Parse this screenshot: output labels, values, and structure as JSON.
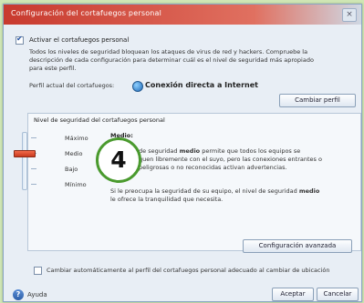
{
  "window": {
    "title": "Configuración del cortafuegos personal",
    "close_glyph": "×"
  },
  "main": {
    "enable_checkbox_label": "Activar el cortafuegos personal",
    "enable_checked": true,
    "description_line1": "Todos los niveles de seguridad bloquean los ataques de virus de red y hackers. Compruebe la",
    "description_line2": "descripción de cada configuración para determinar cuál es el nivel de seguridad más apropiado",
    "description_line3": "para este perfil.",
    "profile_label": "Perfil actual del cortafuegos:",
    "profile_value": "Conexión directa a Internet",
    "change_profile_button": "Cambiar perfil"
  },
  "security_group": {
    "title": "Nivel de seguridad del cortafuegos personal",
    "levels": [
      "Máximo",
      "Medio",
      "Bajo",
      "Mínimo"
    ],
    "selected_level": "Medio",
    "heading": "Medio:",
    "desc_line1_a": "de seguridad ",
    "desc_line1_bold": "medio",
    "desc_line1_b": " permite que todos los equipos se",
    "desc_line2": "quen libremente con el suyo, pero las conexiones entrantes o",
    "desc_line3": "peligrosas o no reconocidas activan advertencias.",
    "desc_line4_a": "Si le preocupa la seguridad de su equipo, el nivel de seguridad ",
    "desc_line4_bold": "medio",
    "desc_line5": "le ofrece la tranquilidad que necesita.",
    "advanced_button": "Configuración avanzada"
  },
  "auto_change": {
    "label": "Cambiar automáticamente al perfil del cortafuegos personal adecuado al cambiar de ubicación",
    "checked": false
  },
  "footer": {
    "help_button": "Ayuda",
    "help_icon_glyph": "?",
    "accept_button": "Aceptar",
    "cancel_button": "Cancelar"
  },
  "overlay": {
    "step_number": "4"
  },
  "colors": {
    "titlebar": "#c83a2e",
    "badge_ring": "#4a9a2e",
    "slider_thumb": "#e0502e"
  }
}
